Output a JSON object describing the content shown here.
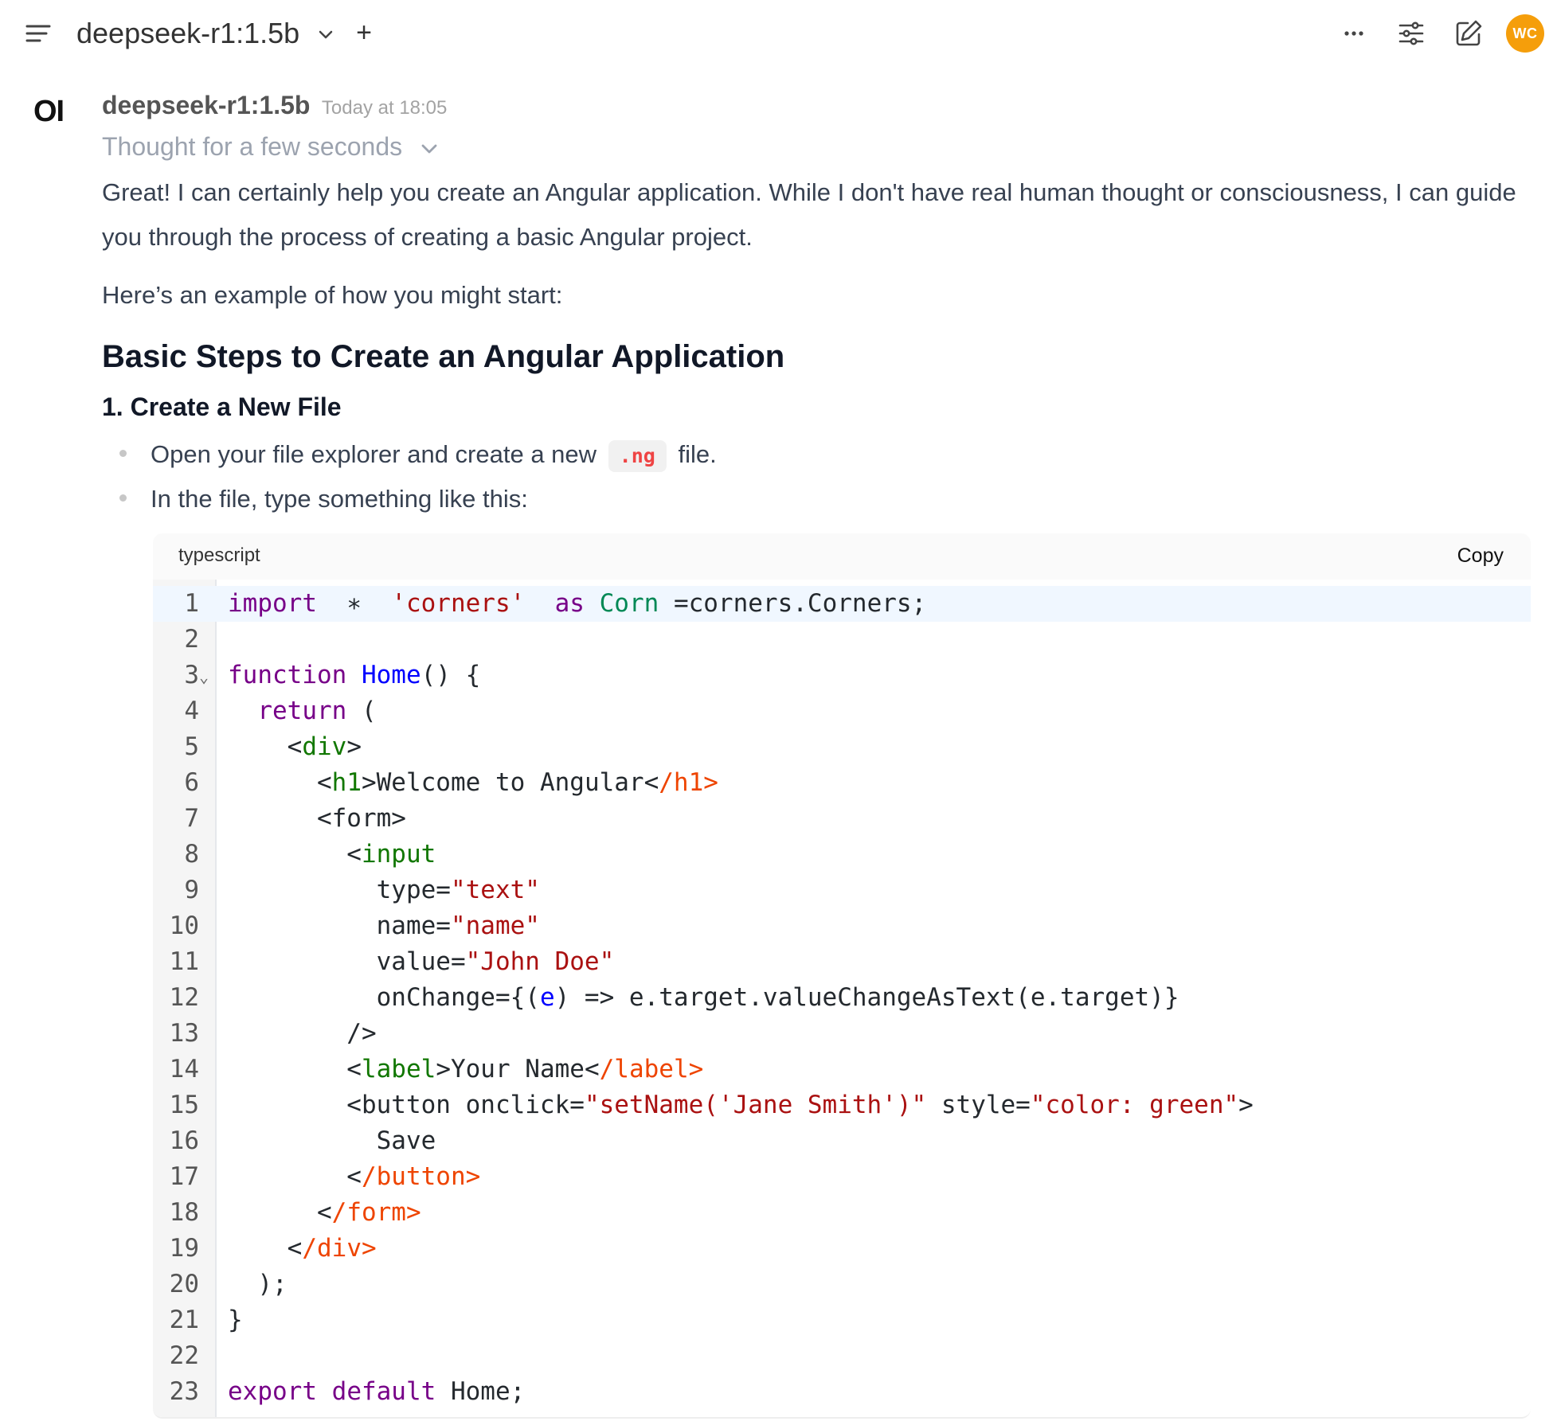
{
  "header": {
    "model_name": "deepseek-r1:1.5b",
    "add_model_label": "+",
    "user_initials": "WC",
    "colors": {
      "avatar": "#f59e0b"
    },
    "icons": [
      "menu-icon",
      "chevron-down-icon",
      "more-icon",
      "sliders-icon",
      "edit-icon"
    ]
  },
  "message": {
    "avatar_text": "OI",
    "model_name": "deepseek-r1:1.5b",
    "timestamp": "Today at 18:05",
    "thought_label": "Thought for a few seconds",
    "paragraph1": "Great! I can certainly help you create an Angular application. While I don't have real human thought or consciousness, I can guide you through the process of creating a basic Angular project.",
    "paragraph2": "Here’s an example of how you might start:",
    "heading": "Basic Steps to Create an Angular Application",
    "subheading": "1. Create a New File",
    "bullets": [
      {
        "before": "Open your file explorer and create a new",
        "code": ".ng",
        "after": "file."
      },
      {
        "text": "In the file, type something like this:"
      }
    ]
  },
  "code": {
    "language": "typescript",
    "copy_label": "Copy",
    "active_line": 1,
    "fold_marker": "⌄",
    "lines": [
      [
        [
          "kw",
          "import"
        ],
        [
          "",
          "  "
        ],
        [
          "",
          "∗"
        ],
        [
          "",
          "  "
        ],
        [
          "str",
          "'corners'"
        ],
        [
          "",
          "  "
        ],
        [
          "kw",
          "as"
        ],
        [
          "",
          " "
        ],
        [
          "typ",
          "Corn"
        ],
        [
          "",
          " =corners.Corners;"
        ]
      ],
      [],
      [
        [
          "kw",
          "function"
        ],
        [
          "",
          " "
        ],
        [
          "def",
          "Home"
        ],
        [
          "",
          "() {"
        ]
      ],
      [
        [
          "",
          "  "
        ],
        [
          "kw",
          "return"
        ],
        [
          "",
          " ("
        ]
      ],
      [
        [
          "",
          "    <"
        ],
        [
          "tag",
          "div"
        ],
        [
          "",
          ">"
        ]
      ],
      [
        [
          "",
          "      <"
        ],
        [
          "tag",
          "h1"
        ],
        [
          "",
          ">Welcome to Angular<"
        ],
        [
          "ctag",
          "/h1>"
        ]
      ],
      [
        [
          "",
          "      <form>"
        ]
      ],
      [
        [
          "",
          "        <"
        ],
        [
          "tag",
          "input"
        ]
      ],
      [
        [
          "",
          "          type="
        ],
        [
          "str",
          "\"text\""
        ]
      ],
      [
        [
          "",
          "          name="
        ],
        [
          "str",
          "\"name\""
        ]
      ],
      [
        [
          "",
          "          value="
        ],
        [
          "str",
          "\"John Doe\""
        ]
      ],
      [
        [
          "",
          "          onChange={("
        ],
        [
          "def",
          "e"
        ],
        [
          "",
          ") => e.target.valueChangeAsText(e.target)}"
        ]
      ],
      [
        [
          "",
          "        />"
        ]
      ],
      [
        [
          "",
          "        <"
        ],
        [
          "tag",
          "label"
        ],
        [
          "",
          ">Your Name<"
        ],
        [
          "ctag",
          "/label>"
        ]
      ],
      [
        [
          "",
          "        <button onclick="
        ],
        [
          "str",
          "\"setName('Jane Smith')\""
        ],
        [
          "",
          " style="
        ],
        [
          "str",
          "\"color: green\""
        ],
        [
          "",
          ">"
        ]
      ],
      [
        [
          "",
          "          Save"
        ]
      ],
      [
        [
          "",
          "        <"
        ],
        [
          "ctag",
          "/button>"
        ]
      ],
      [
        [
          "",
          "      <"
        ],
        [
          "ctag",
          "/form>"
        ]
      ],
      [
        [
          "",
          "    <"
        ],
        [
          "ctag",
          "/div>"
        ]
      ],
      [
        [
          "",
          "  );"
        ]
      ],
      [
        [
          "",
          "}"
        ]
      ],
      [],
      [
        [
          "kw",
          "export"
        ],
        [
          "",
          " "
        ],
        [
          "kw",
          "default"
        ],
        [
          "",
          " Home;"
        ]
      ]
    ]
  }
}
